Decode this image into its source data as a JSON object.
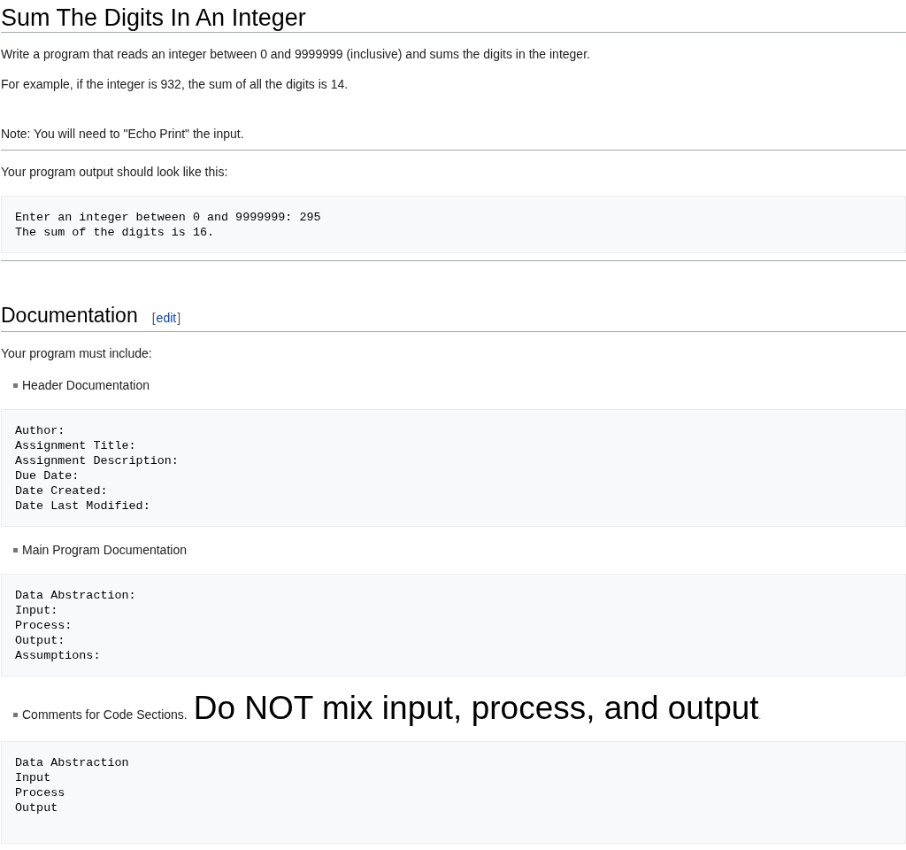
{
  "blocks": [
    {
      "kind": "title",
      "text": "Sum The Digits In An Integer"
    },
    {
      "kind": "paragraph",
      "text": "Write a program that reads an integer between 0 and 9999999 (inclusive) and sums the digits in the integer."
    },
    {
      "kind": "paragraph",
      "text": "For example, if the integer is 932, the sum of all the digits is 14."
    },
    {
      "kind": "spacer"
    },
    {
      "kind": "paragraph",
      "text": "Note: You will need to \"Echo Print\" the input."
    },
    {
      "kind": "rule"
    },
    {
      "kind": "paragraph",
      "text": "Your program output should look like this:"
    },
    {
      "kind": "code",
      "lines": [
        "Enter an integer between 0 and 9999999: 295",
        "The sum of the digits is 16."
      ]
    },
    {
      "kind": "rule"
    },
    {
      "kind": "section",
      "text": "Documentation",
      "edit": {
        "open": "[",
        "link": "edit",
        "close": "]"
      }
    },
    {
      "kind": "paragraph",
      "text": "Your program must include:"
    },
    {
      "kind": "bullet",
      "text": "Header Documentation"
    },
    {
      "kind": "code",
      "lines": [
        "Author:",
        "Assignment Title:",
        "Assignment Description:",
        "Due Date:",
        "Date Created:",
        "Date Last Modified:"
      ]
    },
    {
      "kind": "bullet",
      "text": "Main Program Documentation"
    },
    {
      "kind": "code",
      "lines": [
        "Data Abstraction:",
        "Input:",
        "Process:",
        "Output:",
        "Assumptions:"
      ]
    },
    {
      "kind": "bullet",
      "text": "Comments for Code Sections.",
      "callout": "Do NOT mix input, process, and output",
      "callout_end": "."
    },
    {
      "kind": "code",
      "lines": [
        "Data Abstraction",
        "Input",
        "Process",
        "Output"
      ]
    }
  ]
}
